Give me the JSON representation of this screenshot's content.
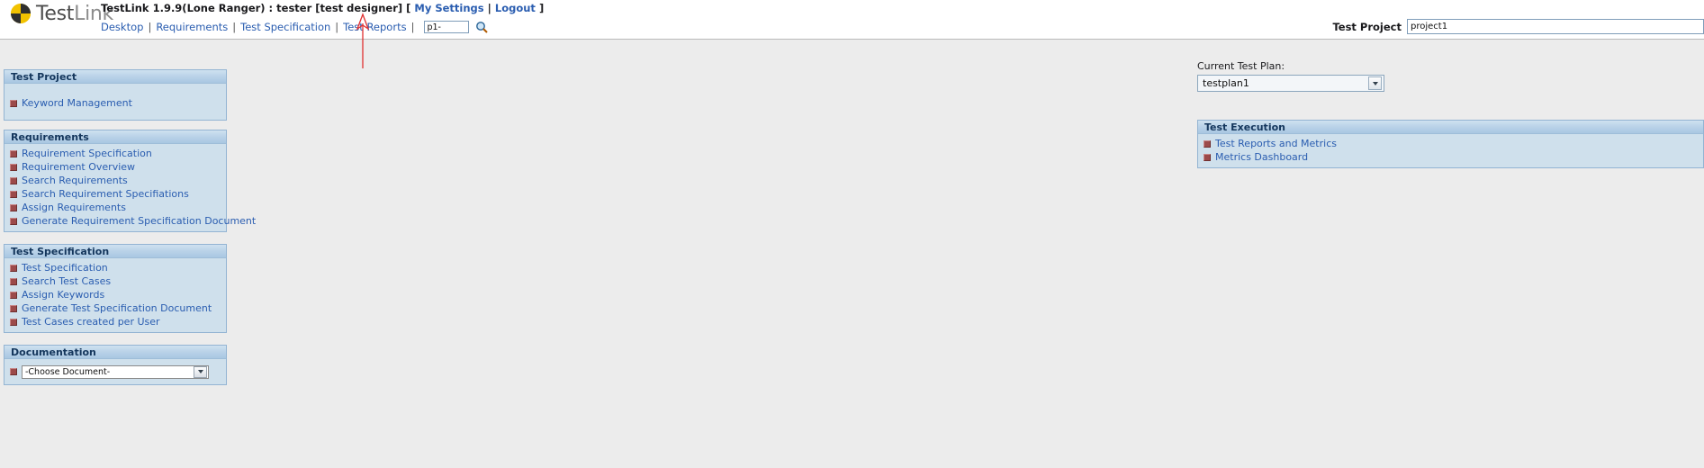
{
  "header": {
    "logo_text_1": "Test",
    "logo_text_2": "Link",
    "title": "TestLink 1.9.9(Lone Ranger) : tester [test designer] [",
    "my_settings": "My Settings",
    "separator_mid": "|",
    "logout": "Logout",
    "title_close": "]",
    "nav": [
      {
        "label": "Desktop"
      },
      {
        "label": "Requirements"
      },
      {
        "label": "Test Specification"
      },
      {
        "label": "Test Reports"
      }
    ],
    "nav_separator": "|",
    "search_value": "p1-",
    "search_placeholder": "",
    "magnifier_icon": "search-icon",
    "project_label": "Test Project",
    "project_value": "project1"
  },
  "sidebar": {
    "panels": [
      {
        "title": "Test Project",
        "items": [
          {
            "label": "Keyword Management"
          }
        ]
      },
      {
        "title": "Requirements",
        "items": [
          {
            "label": "Requirement Specification"
          },
          {
            "label": "Requirement Overview"
          },
          {
            "label": "Search Requirements"
          },
          {
            "label": "Search Requirement Specifiations"
          },
          {
            "label": "Assign Requirements"
          },
          {
            "label": "Generate Requirement Specification Document"
          }
        ]
      },
      {
        "title": "Test Specification",
        "items": [
          {
            "label": "Test Specification"
          },
          {
            "label": "Search Test Cases"
          },
          {
            "label": "Assign Keywords"
          },
          {
            "label": "Generate Test Specification Document"
          },
          {
            "label": "Test Cases created per User"
          }
        ]
      },
      {
        "title": "Documentation",
        "items": [],
        "document_select_value": "-Choose Document-"
      }
    ]
  },
  "right": {
    "current_plan_label": "Current Test Plan:",
    "current_plan_value": "testplan1",
    "execution_panel": {
      "title": "Test Execution",
      "items": [
        {
          "label": "Test Reports and Metrics"
        },
        {
          "label": "Metrics Dashboard"
        }
      ]
    }
  },
  "annotation": {
    "arrow_color": "#e03030",
    "points_at": "Test Reports"
  }
}
